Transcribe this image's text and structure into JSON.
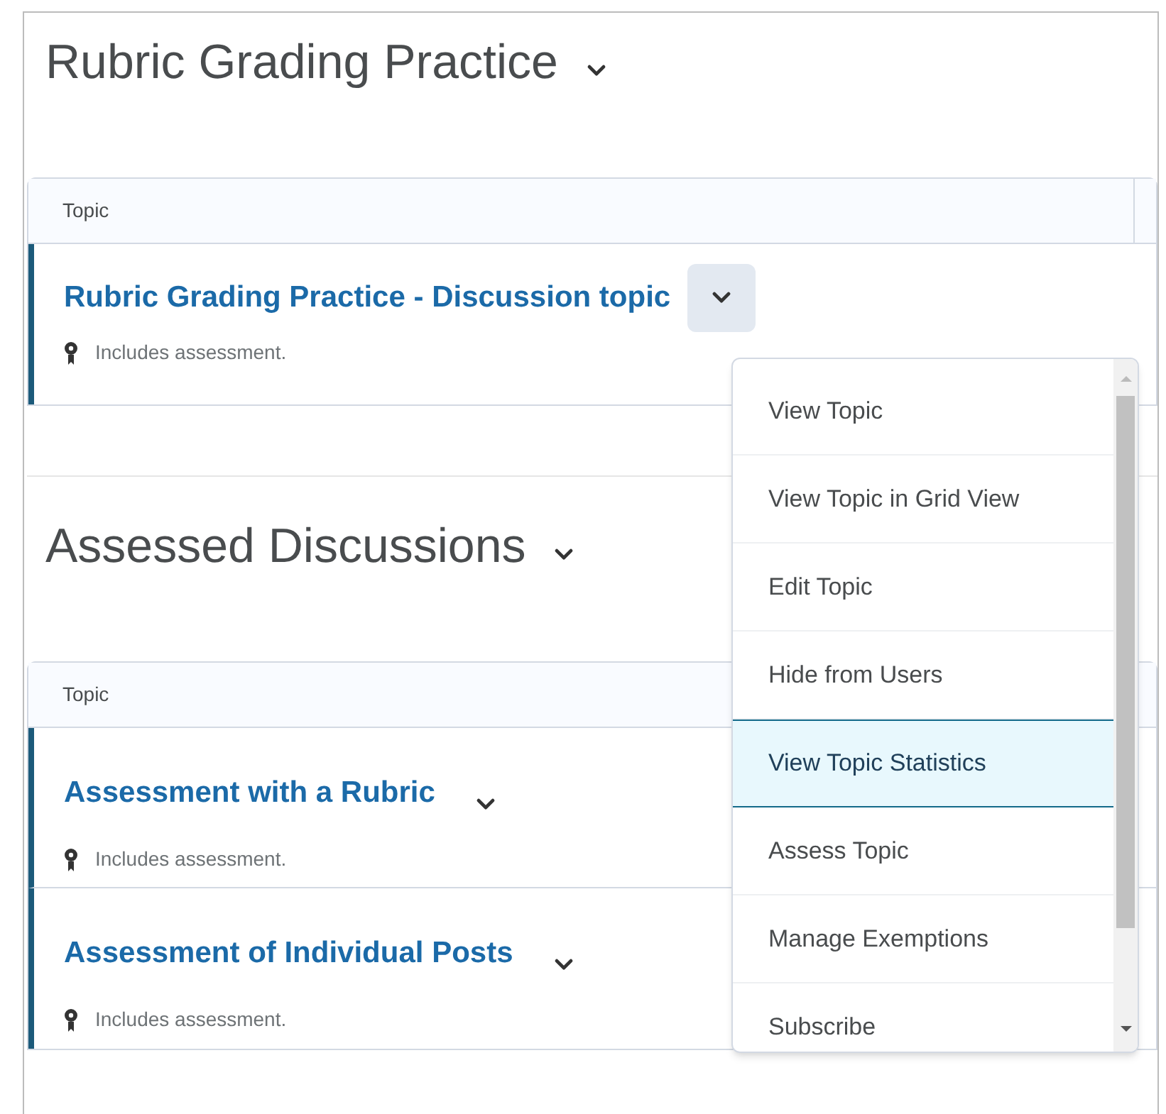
{
  "sections": [
    {
      "title": "Rubric Grading Practice",
      "column": "Topic",
      "topics": [
        {
          "title": "Rubric Grading Practice - Discussion topic",
          "note": "Includes assessment.",
          "menu_open": true
        }
      ]
    },
    {
      "title": "Assessed Discussions",
      "column": "Topic",
      "topics": [
        {
          "title": "Assessment with a Rubric",
          "note": "Includes assessment.",
          "menu_open": false
        },
        {
          "title": "Assessment of Individual Posts",
          "note": "Includes assessment.",
          "menu_open": false
        }
      ]
    }
  ],
  "menu": [
    {
      "label": "View Topic",
      "selected": false
    },
    {
      "label": "View Topic in Grid View",
      "selected": false
    },
    {
      "label": "Edit Topic",
      "selected": false
    },
    {
      "label": "Hide from Users",
      "selected": false
    },
    {
      "label": "View Topic Statistics",
      "selected": true
    },
    {
      "label": "Assess Topic",
      "selected": false
    },
    {
      "label": "Manage Exemptions",
      "selected": false
    },
    {
      "label": "Subscribe",
      "selected": false
    }
  ]
}
